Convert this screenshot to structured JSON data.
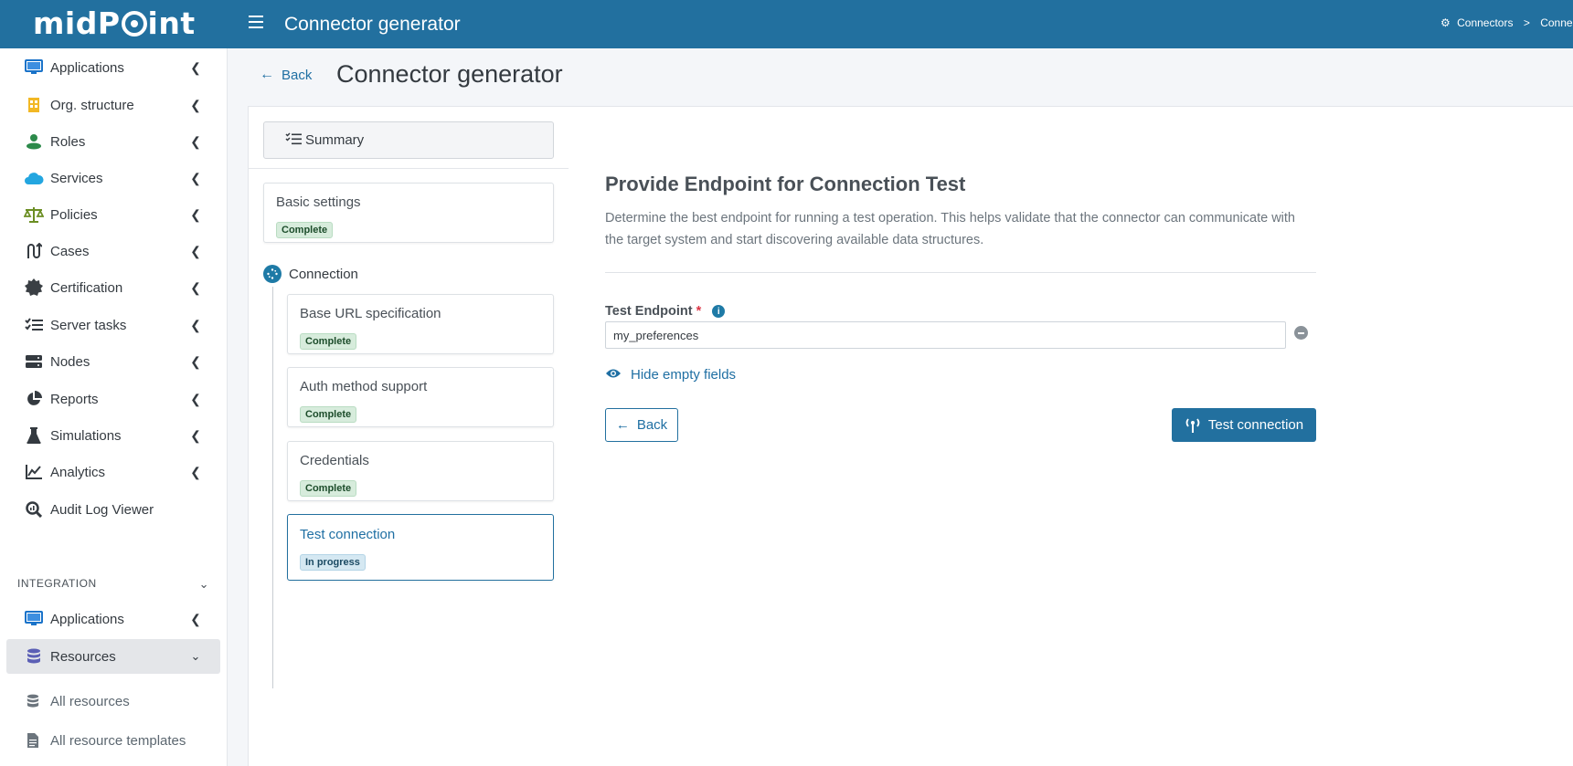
{
  "topbar": {
    "logo_text_a": "midP",
    "logo_text_b": "int",
    "title": "Connector generator",
    "breadcrumb": [
      "Connectors",
      ">",
      "Connec"
    ]
  },
  "sidebar": {
    "items": [
      {
        "label": "Applications",
        "icon": "monitor-icon"
      },
      {
        "label": "Org. structure",
        "icon": "building-icon"
      },
      {
        "label": "Roles",
        "icon": "user-role-icon"
      },
      {
        "label": "Services",
        "icon": "cloud-icon"
      },
      {
        "label": "Policies",
        "icon": "scale-icon"
      },
      {
        "label": "Cases",
        "icon": "route-icon"
      },
      {
        "label": "Certification",
        "icon": "certificate-icon"
      },
      {
        "label": "Server tasks",
        "icon": "task-list-icon"
      },
      {
        "label": "Nodes",
        "icon": "server-icon"
      },
      {
        "label": "Reports",
        "icon": "pie-chart-icon"
      },
      {
        "label": "Simulations",
        "icon": "flask-icon"
      },
      {
        "label": "Analytics",
        "icon": "line-chart-icon"
      },
      {
        "label": "Audit Log Viewer",
        "icon": "search-chart-icon"
      }
    ],
    "section_header": "INTEGRATION",
    "integration_items": [
      {
        "label": "Applications",
        "icon": "monitor-icon"
      },
      {
        "label": "Resources",
        "icon": "database-icon"
      }
    ],
    "sub_items": [
      {
        "label": "All resources",
        "icon": "database-icon"
      },
      {
        "label": "All resource templates",
        "icon": "file-icon"
      }
    ]
  },
  "page": {
    "back_label": "Back",
    "title": "Connector generator"
  },
  "wizard": {
    "summary_label": "Summary",
    "basic_settings": {
      "title": "Basic settings",
      "status": "Complete"
    },
    "connection_label": "Connection",
    "steps": [
      {
        "title": "Base URL specification",
        "status": "Complete"
      },
      {
        "title": "Auth method support",
        "status": "Complete"
      },
      {
        "title": "Credentials",
        "status": "Complete"
      },
      {
        "title": "Test connection",
        "status": "In progress"
      }
    ]
  },
  "panel": {
    "title": "Provide Endpoint for Connection Test",
    "description": "Determine the best endpoint for running a test operation. This helps validate that the connector can communicate with the target system and start discovering available data structures.",
    "field_label": "Test Endpoint",
    "required_mark": "*",
    "info_mark": "i",
    "field_value": "my_preferences",
    "hide_empty_label": "Hide empty fields",
    "back_button": "Back",
    "test_button": "Test connection"
  },
  "colors": {
    "topbar": "#22709f",
    "accent": "#1f6fa3",
    "complete_badge": "#d7ecdc",
    "progress_badge": "#d5e8f2"
  }
}
